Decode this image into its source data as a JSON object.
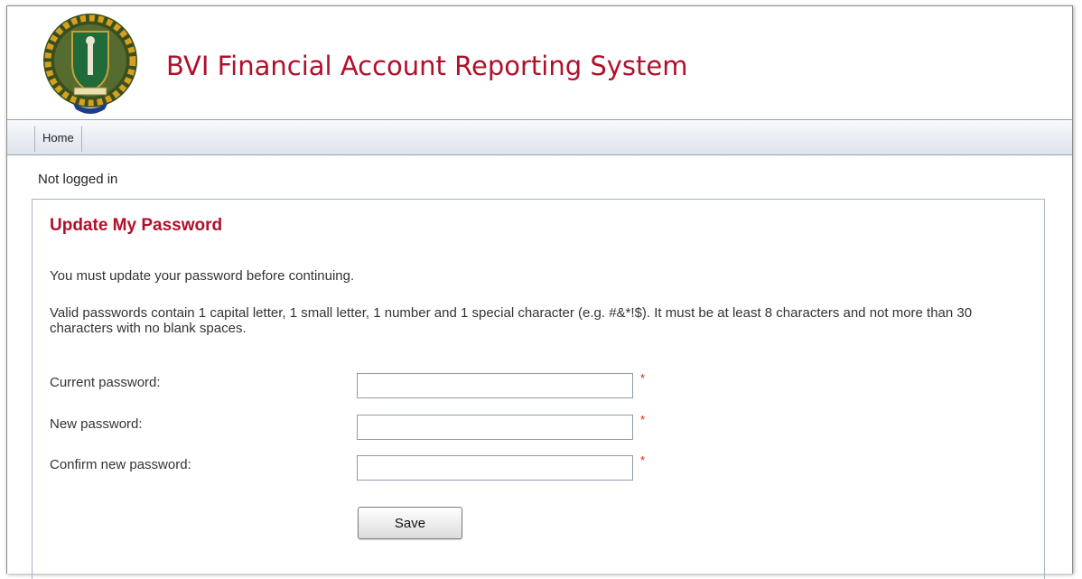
{
  "header": {
    "title": "BVI Financial Account Reporting System",
    "logo": "bvi-coat-of-arms-logo"
  },
  "nav": {
    "items": [
      {
        "label": "Home"
      }
    ]
  },
  "status": {
    "login_text": "Not logged in"
  },
  "panel": {
    "title": "Update My Password",
    "intro": "You must update your password before continuing.",
    "rules": "Valid passwords contain 1 capital letter, 1 small letter, 1 number and 1 special character (e.g. #&*!$). It must be at least 8 characters and not more than 30 characters with no blank spaces."
  },
  "form": {
    "current_password": {
      "label": "Current password:",
      "value": "",
      "required_mark": "*"
    },
    "new_password": {
      "label": "New password:",
      "value": "",
      "required_mark": "*"
    },
    "confirm_password": {
      "label": "Confirm new password:",
      "value": "",
      "required_mark": "*"
    },
    "save_label": "Save"
  },
  "colors": {
    "brand_red": "#b0102a",
    "required_red": "#e0201a",
    "nav_border": "#9aa5b3"
  }
}
